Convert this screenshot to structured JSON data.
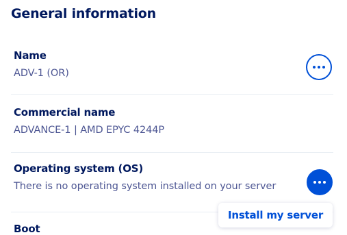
{
  "page": {
    "title": "General information"
  },
  "rows": [
    {
      "label": "Name",
      "value": "ADV-1 (OR)"
    },
    {
      "label": "Commercial name",
      "value": "ADVANCE-1 | AMD EPYC 4244P"
    },
    {
      "label": "Operating system (OS)",
      "value": "There is no operating system installed on your server"
    },
    {
      "label": "Boot",
      "value": ""
    }
  ],
  "actions_menu": {
    "item_label": "Install my server"
  },
  "colors": {
    "heading": "#00185e",
    "value_text": "#4d5693",
    "accent": "#0050d7",
    "divider": "#e8edf3"
  },
  "icons": {
    "more": "ellipsis-icon"
  }
}
